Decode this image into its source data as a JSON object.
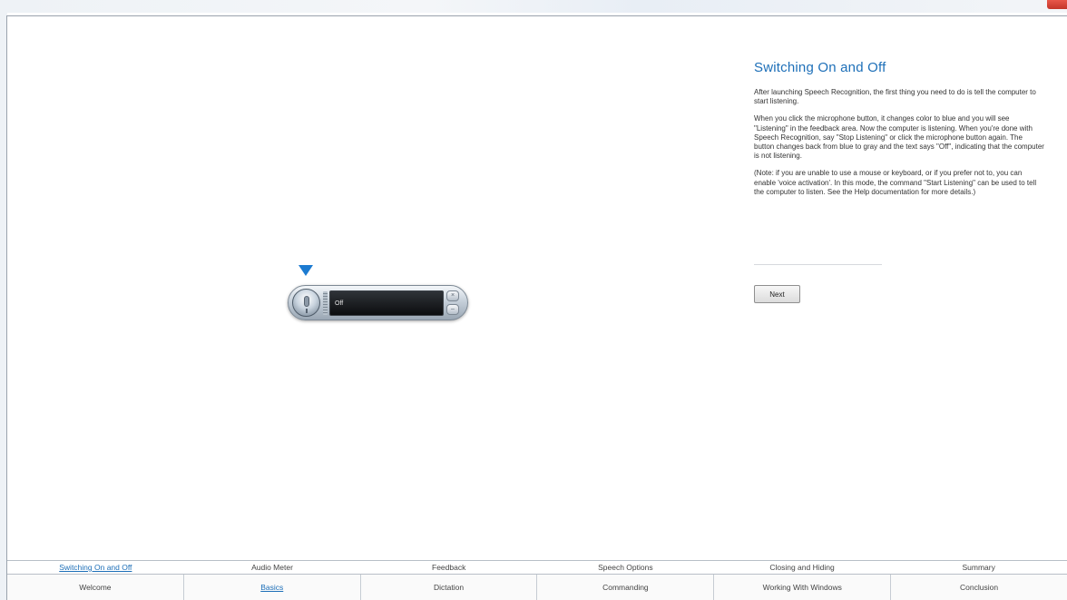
{
  "window": {
    "close_label": ""
  },
  "widget": {
    "feedback_text": "Off"
  },
  "panel": {
    "title": "Switching On and Off",
    "paragraphs": [
      "After launching Speech Recognition, the first thing you need to do is tell the computer to start listening.",
      "When you click the microphone button, it changes color to blue and you will see \"Listening\" in the feedback area. Now the computer is listening. When you're done with Speech Recognition, say \"Stop Listening\" or click the microphone button again. The button changes back from blue to gray and the text says \"Off\", indicating that the computer is not listening.",
      "(Note: if you are unable to use a mouse or keyboard, or if you prefer not to, you can enable 'voice activation'. In this mode, the command \"Start Listening\" can be used to tell the computer to listen. See the Help documentation for more details.)"
    ],
    "next_label": "Next"
  },
  "subnav": {
    "items": [
      {
        "label": "Switching On and Off"
      },
      {
        "label": "Audio Meter"
      },
      {
        "label": "Feedback"
      },
      {
        "label": "Speech Options"
      },
      {
        "label": "Closing and Hiding"
      },
      {
        "label": "Summary"
      }
    ],
    "active_index": 0
  },
  "mainnav": {
    "items": [
      {
        "label": "Welcome"
      },
      {
        "label": "Basics"
      },
      {
        "label": "Dictation"
      },
      {
        "label": "Commanding"
      },
      {
        "label": "Working With Windows"
      },
      {
        "label": "Conclusion"
      }
    ],
    "active_index": 1
  },
  "colors": {
    "accent": "#1d6fb8",
    "pointer": "#1c7bd1",
    "close": "#d4473a"
  }
}
